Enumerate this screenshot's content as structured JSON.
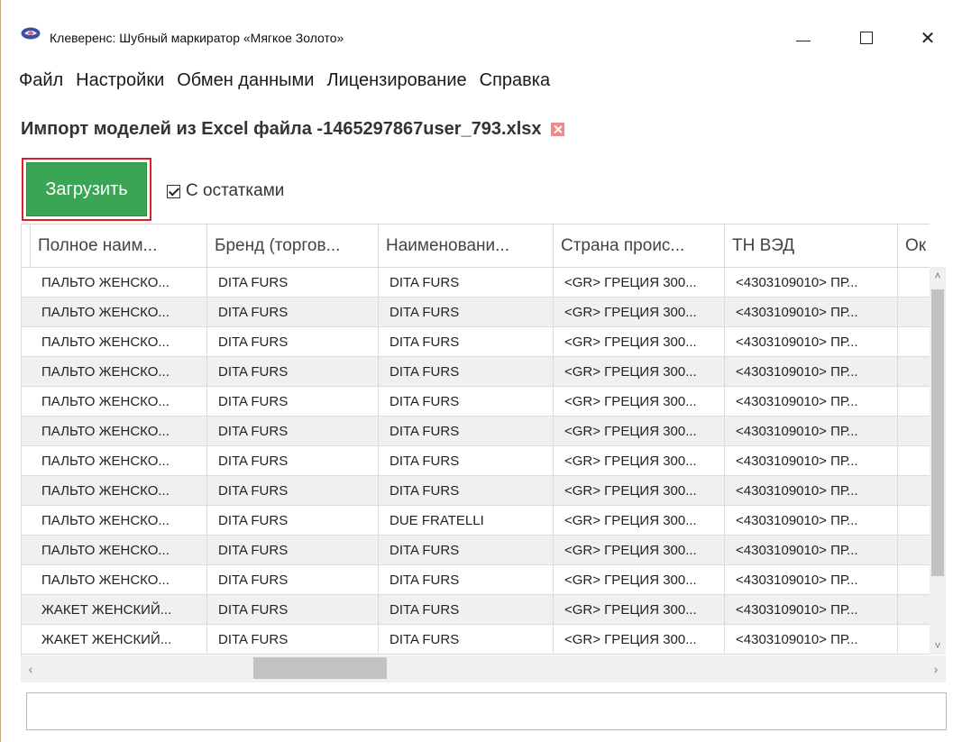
{
  "window": {
    "title": "Клеверенс: Шубный маркиратор «Мягкое Золото»",
    "minimize_glyph": "—",
    "close_glyph": "✕"
  },
  "menu": [
    {
      "label": "Файл"
    },
    {
      "label": "Настройки"
    },
    {
      "label": "Обмен данными"
    },
    {
      "label": "Лицензирование"
    },
    {
      "label": "Справка"
    }
  ],
  "page": {
    "title": "Импорт моделей из Excel файла -1465297867user_793.xlsx"
  },
  "toolbar": {
    "load_label": "Загрузить",
    "with_stock_label": "С остатками",
    "with_stock_checked": true
  },
  "table": {
    "columns": [
      {
        "label": "."
      },
      {
        "label": "Полное наим..."
      },
      {
        "label": "Бренд (торгов..."
      },
      {
        "label": "Наименовани..."
      },
      {
        "label": "Страна проис..."
      },
      {
        "label": "ТН ВЭД"
      },
      {
        "label": "Ок"
      }
    ],
    "rows": [
      [
        "ПАЛЬТО ЖЕНСКО...",
        "DITA FURS",
        "DITA FURS",
        "<GR> ГРЕЦИЯ 300...",
        "<4303109010> ПР..."
      ],
      [
        "ПАЛЬТО ЖЕНСКО...",
        "DITA FURS",
        "DITA FURS",
        "<GR> ГРЕЦИЯ 300...",
        "<4303109010> ПР..."
      ],
      [
        "ПАЛЬТО ЖЕНСКО...",
        "DITA FURS",
        "DITA FURS",
        "<GR> ГРЕЦИЯ 300...",
        "<4303109010> ПР..."
      ],
      [
        "ПАЛЬТО ЖЕНСКО...",
        "DITA FURS",
        "DITA FURS",
        "<GR> ГРЕЦИЯ 300...",
        "<4303109010> ПР..."
      ],
      [
        "ПАЛЬТО ЖЕНСКО...",
        "DITA FURS",
        "DITA FURS",
        "<GR> ГРЕЦИЯ 300...",
        "<4303109010> ПР..."
      ],
      [
        "ПАЛЬТО ЖЕНСКО...",
        "DITA FURS",
        "DITA FURS",
        "<GR> ГРЕЦИЯ 300...",
        "<4303109010> ПР..."
      ],
      [
        "ПАЛЬТО ЖЕНСКО...",
        "DITA FURS",
        "DITA FURS",
        "<GR> ГРЕЦИЯ 300...",
        "<4303109010> ПР..."
      ],
      [
        "ПАЛЬТО ЖЕНСКО...",
        "DITA FURS",
        "DITA FURS",
        "<GR> ГРЕЦИЯ 300...",
        "<4303109010> ПР..."
      ],
      [
        "ПАЛЬТО ЖЕНСКО...",
        "DITA FURS",
        "DUE FRATELLI",
        "<GR> ГРЕЦИЯ 300...",
        "<4303109010> ПР..."
      ],
      [
        "ПАЛЬТО ЖЕНСКО...",
        "DITA FURS",
        "DITA FURS",
        "<GR> ГРЕЦИЯ 300...",
        "<4303109010> ПР..."
      ],
      [
        "ПАЛЬТО ЖЕНСКО...",
        "DITA FURS",
        "DITA FURS",
        "<GR> ГРЕЦИЯ 300...",
        "<4303109010> ПР..."
      ],
      [
        "ЖАКЕТ ЖЕНСКИЙ...",
        "DITA FURS",
        "DITA FURS",
        "<GR> ГРЕЦИЯ 300...",
        "<4303109010> ПР..."
      ],
      [
        "ЖАКЕТ ЖЕНСКИЙ...",
        "DITA FURS",
        "DITA FURS",
        "<GR> ГРЕЦИЯ 300...",
        "<4303109010> ПР..."
      ]
    ]
  },
  "scroll": {
    "up": "˄",
    "down": "˅",
    "left": "‹",
    "right": "›"
  },
  "status": {
    "value": ""
  },
  "colors": {
    "load_button": "#3aa655",
    "highlight_frame": "#e02020",
    "app_icon": "#3b4fa8"
  }
}
